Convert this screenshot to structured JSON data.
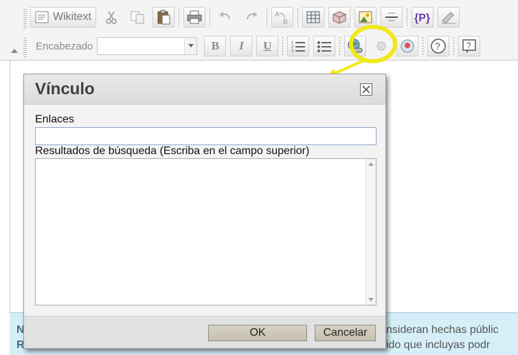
{
  "toolbar": {
    "row1": {
      "wikitext_label": "Wikitext",
      "buttons": [
        "wikitext-button",
        "cut-button",
        "copy-button",
        "paste-button",
        "print-button",
        "undo-button",
        "redo-button",
        "find-replace-button",
        "table-button",
        "widget-button",
        "image-button",
        "horizontal-rule-button",
        "template-button",
        "signature-button"
      ]
    },
    "row2": {
      "heading_label": "Encabezado",
      "heading_value": "",
      "bold_label": "B",
      "italic_label": "I",
      "underline_label": "U"
    }
  },
  "highlight": {
    "color": "#f1e817"
  },
  "dialog": {
    "title": "Vínculo",
    "links_label": "Enlaces",
    "links_value": "",
    "results_label": "Resultados de búsqueda (Escriba en el campo superior)",
    "ok_label": "OK",
    "cancel_label": "Cancelar"
  },
  "notice": {
    "line1_bold": "N",
    "line1": "nsideran hechas públic",
    "line2_bold": "R",
    "line2": "ido que incluyas podr"
  },
  "colors": {
    "accent": "#f1e817",
    "notice_bg": "#d6eef7",
    "dialog_button": "#c9c3b4"
  }
}
